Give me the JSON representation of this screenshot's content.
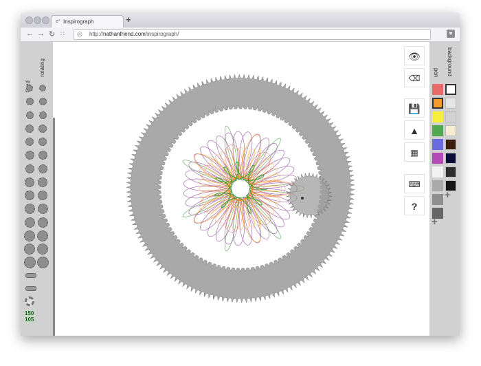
{
  "browser": {
    "tab_title": "Inspirograph",
    "favicon": "e°",
    "new_tab_label": "+",
    "url_prefix": "http://",
    "url_host": "nathanfriend.com",
    "url_path": "/inspirograph/"
  },
  "left_panel": {
    "fixed_label": "fixed",
    "rotating_label": "rotating",
    "counter_top": "150",
    "counter_bottom": "105"
  },
  "tools": {
    "help_label": "?"
  },
  "right_panel": {
    "background_label": "background",
    "pen_label": "pen",
    "add_label": "+",
    "pen_colors": [
      "#e86a6a",
      "#f39a2a",
      "#f5ef3a",
      "#52a852",
      "#6b6be0",
      "#b44ab4",
      "#f2f2f2",
      "#aaaaaa",
      "#8f8f8f",
      "#666666"
    ],
    "background_colors": [
      "#ffffff",
      "#e6e6e6",
      "#d2d2d2",
      "#f6ecd2",
      "#3a1e0e",
      "#0c0c3a",
      "#2e2e2e",
      "#151515"
    ],
    "selected_pen": "#f39a2a",
    "selected_background": "#ffffff"
  },
  "colors": {
    "gear_ring": "#a9a9a9",
    "rotating_gear": "#9f9f9f",
    "pattern_green": "#3b9e3b",
    "pattern_orange": "#f08c10",
    "pattern_purple": "#8a3c9a",
    "pattern_red": "#d64a3a",
    "center_green": "#1aa01a"
  }
}
